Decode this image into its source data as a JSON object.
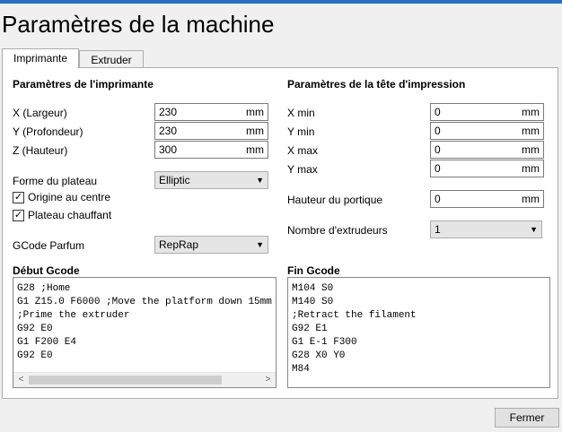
{
  "window": {
    "title": "Paramètres de la machine"
  },
  "tabs": [
    {
      "label": "Imprimante",
      "active": true
    },
    {
      "label": "Extruder",
      "active": false
    }
  ],
  "printer_settings": {
    "heading": "Paramètres de l'imprimante",
    "x_label": "X (Largeur)",
    "x_value": "230",
    "x_unit": "mm",
    "y_label": "Y (Profondeur)",
    "y_value": "230",
    "y_unit": "mm",
    "z_label": "Z (Hauteur)",
    "z_value": "300",
    "z_unit": "mm",
    "bed_shape_label": "Forme du plateau",
    "bed_shape_value": "Elliptic",
    "origin_center_label": "Origine au centre",
    "origin_center_checked": true,
    "heated_bed_label": "Plateau chauffant",
    "heated_bed_checked": true,
    "gcode_flavor_label": "GCode Parfum",
    "gcode_flavor_value": "RepRap"
  },
  "head_settings": {
    "heading": "Paramètres de la tête d'impression",
    "xmin_label": "X min",
    "xmin_value": "0",
    "xmin_unit": "mm",
    "ymin_label": "Y min",
    "ymin_value": "0",
    "ymin_unit": "mm",
    "xmax_label": "X max",
    "xmax_value": "0",
    "xmax_unit": "mm",
    "ymax_label": "Y max",
    "ymax_value": "0",
    "ymax_unit": "mm",
    "gantry_label": "Hauteur du portique",
    "gantry_value": "0",
    "gantry_unit": "mm",
    "extruders_label": "Nombre d'extrudeurs",
    "extruders_value": "1"
  },
  "start_gcode": {
    "heading": "Début Gcode",
    "lines": [
      "G28 ;Home",
      "G1 Z15.0 F6000 ;Move the platform down 15mm",
      ";Prime the extruder",
      "G92 E0",
      "G1 F200 E4",
      "G92 E0"
    ]
  },
  "end_gcode": {
    "heading": "Fin Gcode",
    "lines": [
      "M104 S0",
      "M140 S0",
      ";Retract the filament",
      "G92 E1",
      "G1 E-1 F300",
      "G28 X0 Y0",
      "M84"
    ]
  },
  "footer": {
    "close_label": "Fermer"
  },
  "icons": {
    "check": "✓",
    "dropdown": "▼",
    "scroll_left": "<",
    "scroll_right": ">"
  },
  "colors": {
    "accent": "#2a6ebd",
    "panel_bg": "#ffffff",
    "window_bg": "#f0f0f0"
  }
}
